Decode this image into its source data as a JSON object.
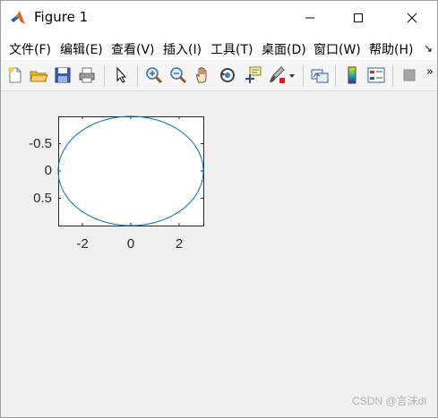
{
  "window": {
    "title": "Figure 1",
    "minimize_glyph": "—",
    "maximize_glyph": "☐",
    "close_glyph": "✕"
  },
  "menu": {
    "items": [
      {
        "label": "文件(F)"
      },
      {
        "label": "编辑(E)"
      },
      {
        "label": "查看(V)"
      },
      {
        "label": "插入(I)"
      },
      {
        "label": "工具(T)"
      },
      {
        "label": "桌面(D)"
      },
      {
        "label": "窗口(W)"
      },
      {
        "label": "帮助(H)"
      }
    ],
    "overflow_glyph": "↘"
  },
  "toolbar": {
    "icons": [
      "new-figure-icon",
      "open-file-icon",
      "save-icon",
      "print-icon",
      "pointer-icon",
      "zoom-in-icon",
      "zoom-out-icon",
      "pan-hand-icon",
      "rotate-3d-icon",
      "data-cursor-icon",
      "brush-icon",
      "brush-dropdown-icon",
      "link-plot-icon",
      "colorbar-icon",
      "legend-icon",
      "hide-plot-tools-icon"
    ],
    "overflow_glyph": "»"
  },
  "chart_data": {
    "type": "line",
    "series": [
      {
        "shape": "ellipse",
        "center": [
          0,
          0
        ],
        "x_radius": 3,
        "y_radius": 1,
        "color": "#0072bd"
      }
    ],
    "xlim": [
      -3,
      3
    ],
    "ylim": [
      -1,
      1
    ],
    "y_direction": "reversed",
    "xticks": [
      -2,
      0,
      2
    ],
    "xtick_labels": [
      "-2",
      "0",
      "2"
    ],
    "yticks": [
      -0.5,
      0,
      0.5
    ],
    "ytick_labels": [
      "-0.5",
      "0",
      "0.5"
    ],
    "grid": false,
    "title": "",
    "xlabel": "",
    "ylabel": ""
  },
  "watermark": "CSDN @言沫dl"
}
